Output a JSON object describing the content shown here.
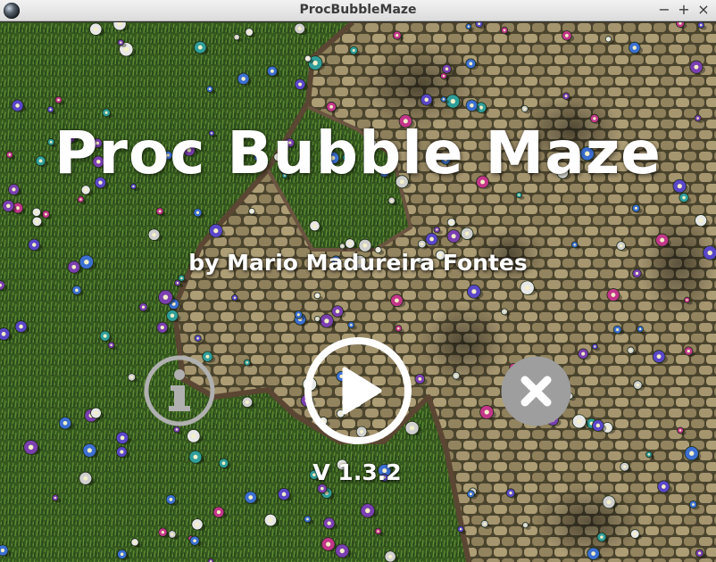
{
  "window": {
    "title": "ProcBubbleMaze",
    "icon": "app-sphere-icon",
    "controls": {
      "minimize": "−",
      "maximize": "+",
      "close": "×"
    }
  },
  "menu": {
    "game_title": "Proc Bubble Maze",
    "author": "by Mario Madureira Fontes",
    "version": "V 1.3.2",
    "buttons": [
      {
        "id": "info",
        "icon": "info-icon"
      },
      {
        "id": "play",
        "icon": "play-icon"
      },
      {
        "id": "exit",
        "icon": "close-icon"
      }
    ]
  },
  "colors": {
    "grass": "#3d6424",
    "grass_dark": "#24401a",
    "stone": "#9a8a64",
    "stone_mortar": "#4b442d",
    "wall": "#5a4632",
    "button_info": "#b0b0b0",
    "button_play": "#ffffff",
    "button_exit": "#9e9e9e",
    "text": "#ffffff"
  }
}
